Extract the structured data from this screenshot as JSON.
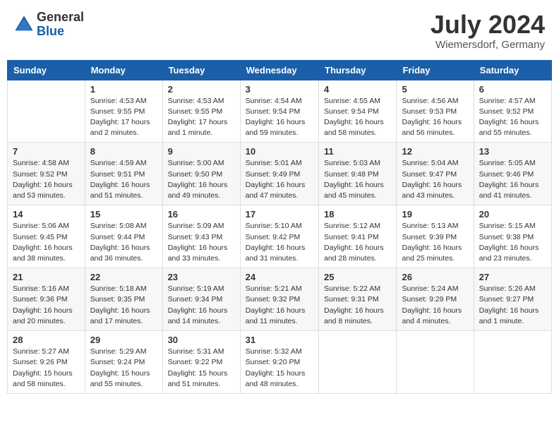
{
  "header": {
    "logo_general": "General",
    "logo_blue": "Blue",
    "month_title": "July 2024",
    "location": "Wiemersdorf, Germany"
  },
  "calendar": {
    "headers": [
      "Sunday",
      "Monday",
      "Tuesday",
      "Wednesday",
      "Thursday",
      "Friday",
      "Saturday"
    ],
    "weeks": [
      [
        {
          "day": "",
          "info": ""
        },
        {
          "day": "1",
          "info": "Sunrise: 4:53 AM\nSunset: 9:55 PM\nDaylight: 17 hours\nand 2 minutes."
        },
        {
          "day": "2",
          "info": "Sunrise: 4:53 AM\nSunset: 9:55 PM\nDaylight: 17 hours\nand 1 minute."
        },
        {
          "day": "3",
          "info": "Sunrise: 4:54 AM\nSunset: 9:54 PM\nDaylight: 16 hours\nand 59 minutes."
        },
        {
          "day": "4",
          "info": "Sunrise: 4:55 AM\nSunset: 9:54 PM\nDaylight: 16 hours\nand 58 minutes."
        },
        {
          "day": "5",
          "info": "Sunrise: 4:56 AM\nSunset: 9:53 PM\nDaylight: 16 hours\nand 56 minutes."
        },
        {
          "day": "6",
          "info": "Sunrise: 4:57 AM\nSunset: 9:52 PM\nDaylight: 16 hours\nand 55 minutes."
        }
      ],
      [
        {
          "day": "7",
          "info": "Sunrise: 4:58 AM\nSunset: 9:52 PM\nDaylight: 16 hours\nand 53 minutes."
        },
        {
          "day": "8",
          "info": "Sunrise: 4:59 AM\nSunset: 9:51 PM\nDaylight: 16 hours\nand 51 minutes."
        },
        {
          "day": "9",
          "info": "Sunrise: 5:00 AM\nSunset: 9:50 PM\nDaylight: 16 hours\nand 49 minutes."
        },
        {
          "day": "10",
          "info": "Sunrise: 5:01 AM\nSunset: 9:49 PM\nDaylight: 16 hours\nand 47 minutes."
        },
        {
          "day": "11",
          "info": "Sunrise: 5:03 AM\nSunset: 9:48 PM\nDaylight: 16 hours\nand 45 minutes."
        },
        {
          "day": "12",
          "info": "Sunrise: 5:04 AM\nSunset: 9:47 PM\nDaylight: 16 hours\nand 43 minutes."
        },
        {
          "day": "13",
          "info": "Sunrise: 5:05 AM\nSunset: 9:46 PM\nDaylight: 16 hours\nand 41 minutes."
        }
      ],
      [
        {
          "day": "14",
          "info": "Sunrise: 5:06 AM\nSunset: 9:45 PM\nDaylight: 16 hours\nand 38 minutes."
        },
        {
          "day": "15",
          "info": "Sunrise: 5:08 AM\nSunset: 9:44 PM\nDaylight: 16 hours\nand 36 minutes."
        },
        {
          "day": "16",
          "info": "Sunrise: 5:09 AM\nSunset: 9:43 PM\nDaylight: 16 hours\nand 33 minutes."
        },
        {
          "day": "17",
          "info": "Sunrise: 5:10 AM\nSunset: 9:42 PM\nDaylight: 16 hours\nand 31 minutes."
        },
        {
          "day": "18",
          "info": "Sunrise: 5:12 AM\nSunset: 9:41 PM\nDaylight: 16 hours\nand 28 minutes."
        },
        {
          "day": "19",
          "info": "Sunrise: 5:13 AM\nSunset: 9:39 PM\nDaylight: 16 hours\nand 25 minutes."
        },
        {
          "day": "20",
          "info": "Sunrise: 5:15 AM\nSunset: 9:38 PM\nDaylight: 16 hours\nand 23 minutes."
        }
      ],
      [
        {
          "day": "21",
          "info": "Sunrise: 5:16 AM\nSunset: 9:36 PM\nDaylight: 16 hours\nand 20 minutes."
        },
        {
          "day": "22",
          "info": "Sunrise: 5:18 AM\nSunset: 9:35 PM\nDaylight: 16 hours\nand 17 minutes."
        },
        {
          "day": "23",
          "info": "Sunrise: 5:19 AM\nSunset: 9:34 PM\nDaylight: 16 hours\nand 14 minutes."
        },
        {
          "day": "24",
          "info": "Sunrise: 5:21 AM\nSunset: 9:32 PM\nDaylight: 16 hours\nand 11 minutes."
        },
        {
          "day": "25",
          "info": "Sunrise: 5:22 AM\nSunset: 9:31 PM\nDaylight: 16 hours\nand 8 minutes."
        },
        {
          "day": "26",
          "info": "Sunrise: 5:24 AM\nSunset: 9:29 PM\nDaylight: 16 hours\nand 4 minutes."
        },
        {
          "day": "27",
          "info": "Sunrise: 5:26 AM\nSunset: 9:27 PM\nDaylight: 16 hours\nand 1 minute."
        }
      ],
      [
        {
          "day": "28",
          "info": "Sunrise: 5:27 AM\nSunset: 9:26 PM\nDaylight: 15 hours\nand 58 minutes."
        },
        {
          "day": "29",
          "info": "Sunrise: 5:29 AM\nSunset: 9:24 PM\nDaylight: 15 hours\nand 55 minutes."
        },
        {
          "day": "30",
          "info": "Sunrise: 5:31 AM\nSunset: 9:22 PM\nDaylight: 15 hours\nand 51 minutes."
        },
        {
          "day": "31",
          "info": "Sunrise: 5:32 AM\nSunset: 9:20 PM\nDaylight: 15 hours\nand 48 minutes."
        },
        {
          "day": "",
          "info": ""
        },
        {
          "day": "",
          "info": ""
        },
        {
          "day": "",
          "info": ""
        }
      ]
    ]
  }
}
